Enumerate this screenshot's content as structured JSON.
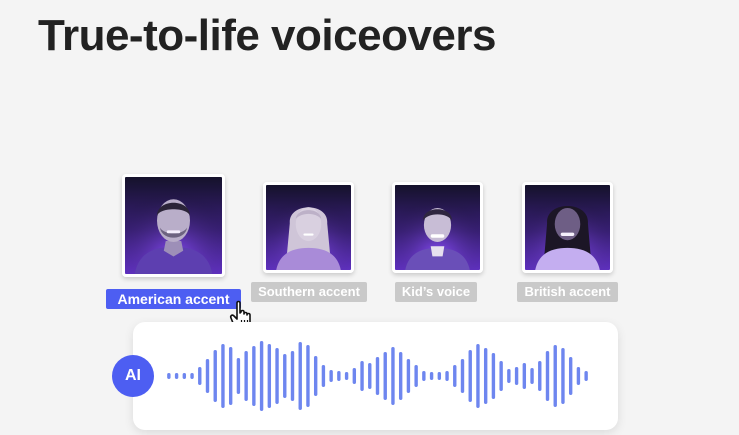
{
  "headline": "True-to-life voiceovers",
  "voices": [
    {
      "label": "American accent",
      "selected": true
    },
    {
      "label": "Southern accent",
      "selected": false
    },
    {
      "label": "Kid’s voice",
      "selected": false
    },
    {
      "label": "British accent",
      "selected": false
    }
  ],
  "ai_badge": "AI",
  "colors": {
    "accent": "#4d5ef2",
    "wave": "#6e86ef",
    "inactive_tag": "#c9c9c9",
    "background": "#f4f4f4"
  },
  "icons": [
    "pointer-hand-icon"
  ]
}
